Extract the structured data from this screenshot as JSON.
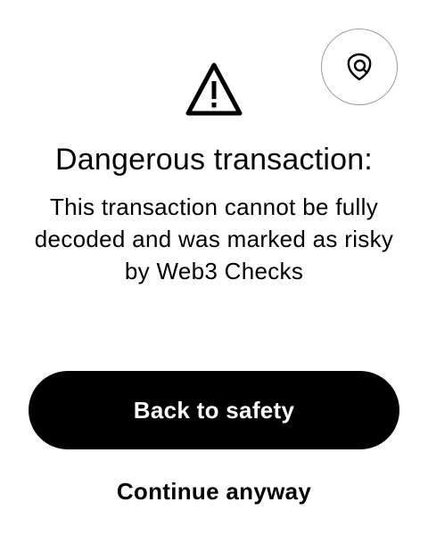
{
  "header": {
    "corner_icon": "shield-search-icon"
  },
  "alert": {
    "icon": "warning-triangle-icon",
    "title": "Dangerous transaction:",
    "message": "This transaction cannot be fully decoded and was marked as risky by Web3 Checks"
  },
  "actions": {
    "primary_label": "Back to safety",
    "secondary_label": "Continue anyway"
  },
  "colors": {
    "background": "#ffffff",
    "text": "#000000",
    "primary_button_bg": "#000000",
    "primary_button_text": "#ffffff",
    "corner_button_border": "#9a9a9a"
  }
}
